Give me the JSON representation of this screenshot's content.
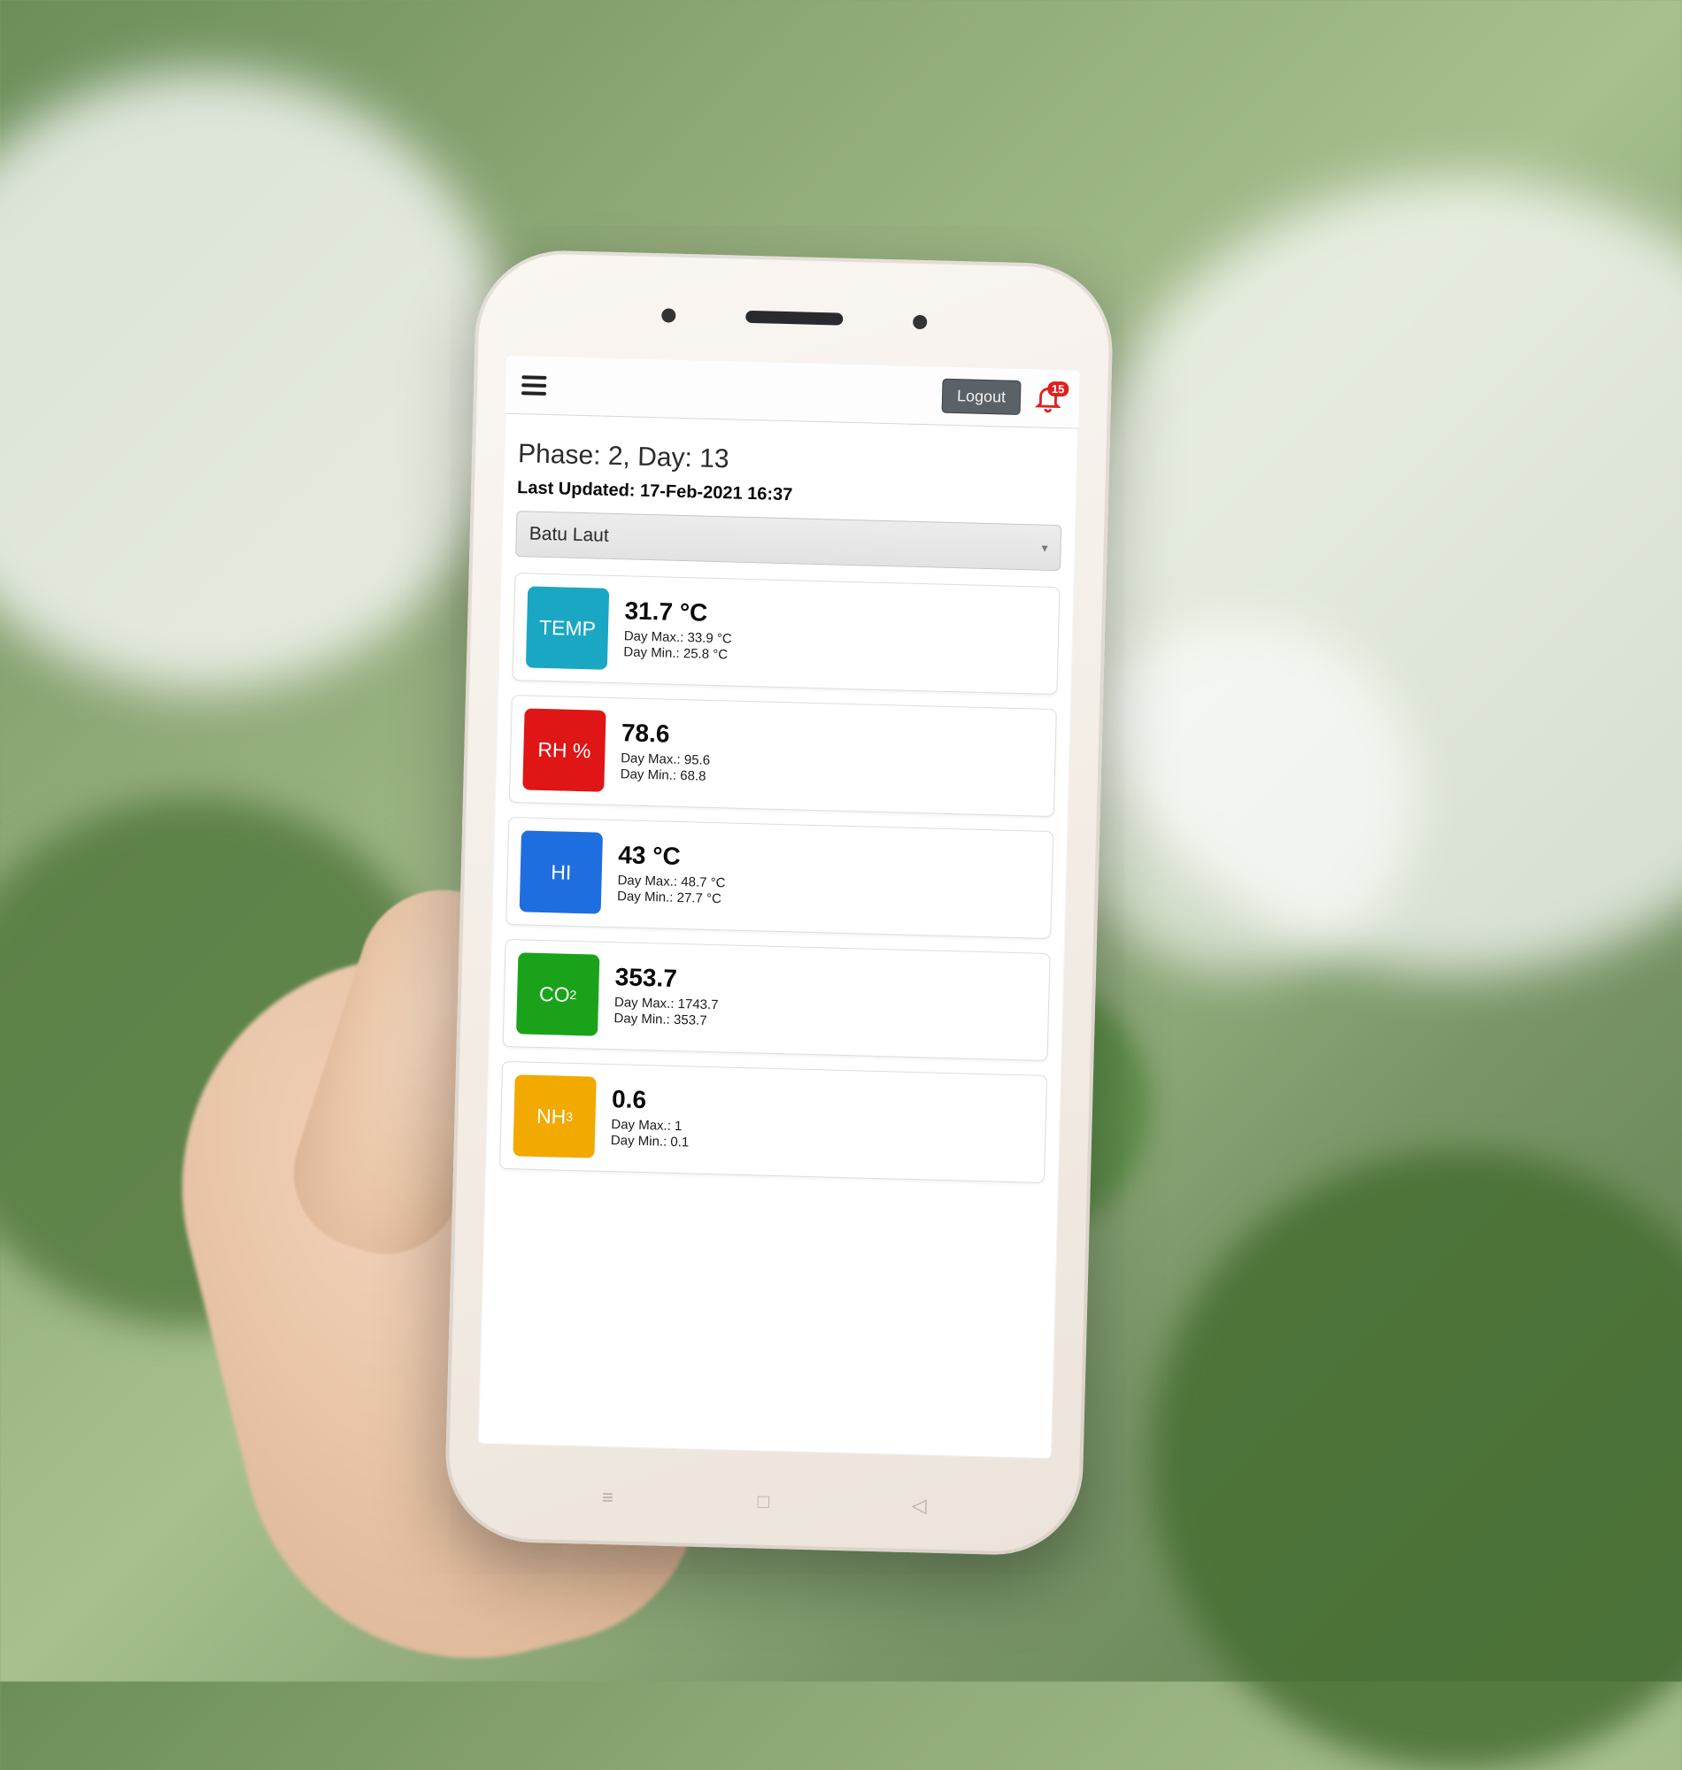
{
  "topbar": {
    "logout_label": "Logout",
    "notification_count": "15"
  },
  "header": {
    "phase_day": "Phase: 2, Day: 13",
    "last_updated": "Last Updated: 17-Feb-2021 16:37"
  },
  "location": {
    "selected": "Batu Laut"
  },
  "metrics": [
    {
      "code": "TEMP",
      "color_class": "temp",
      "value": "31.7 °C",
      "day_max": "Day Max.: 33.9 °C",
      "day_min": "Day Min.: 25.8 °C"
    },
    {
      "code": "RH %",
      "color_class": "rh",
      "value": "78.6",
      "day_max": "Day Max.: 95.6",
      "day_min": "Day Min.: 68.8"
    },
    {
      "code": "HI",
      "color_class": "hi",
      "value": "43 °C",
      "day_max": "Day Max.: 48.7 °C",
      "day_min": "Day Min.: 27.7 °C"
    },
    {
      "code": "CO2",
      "color_class": "co2",
      "value": "353.7",
      "day_max": "Day Max.: 1743.7",
      "day_min": "Day Min.: 353.7"
    },
    {
      "code": "NH3",
      "color_class": "nh3",
      "value": "0.6",
      "day_max": "Day Max.: 1",
      "day_min": "Day Min.: 0.1"
    }
  ]
}
